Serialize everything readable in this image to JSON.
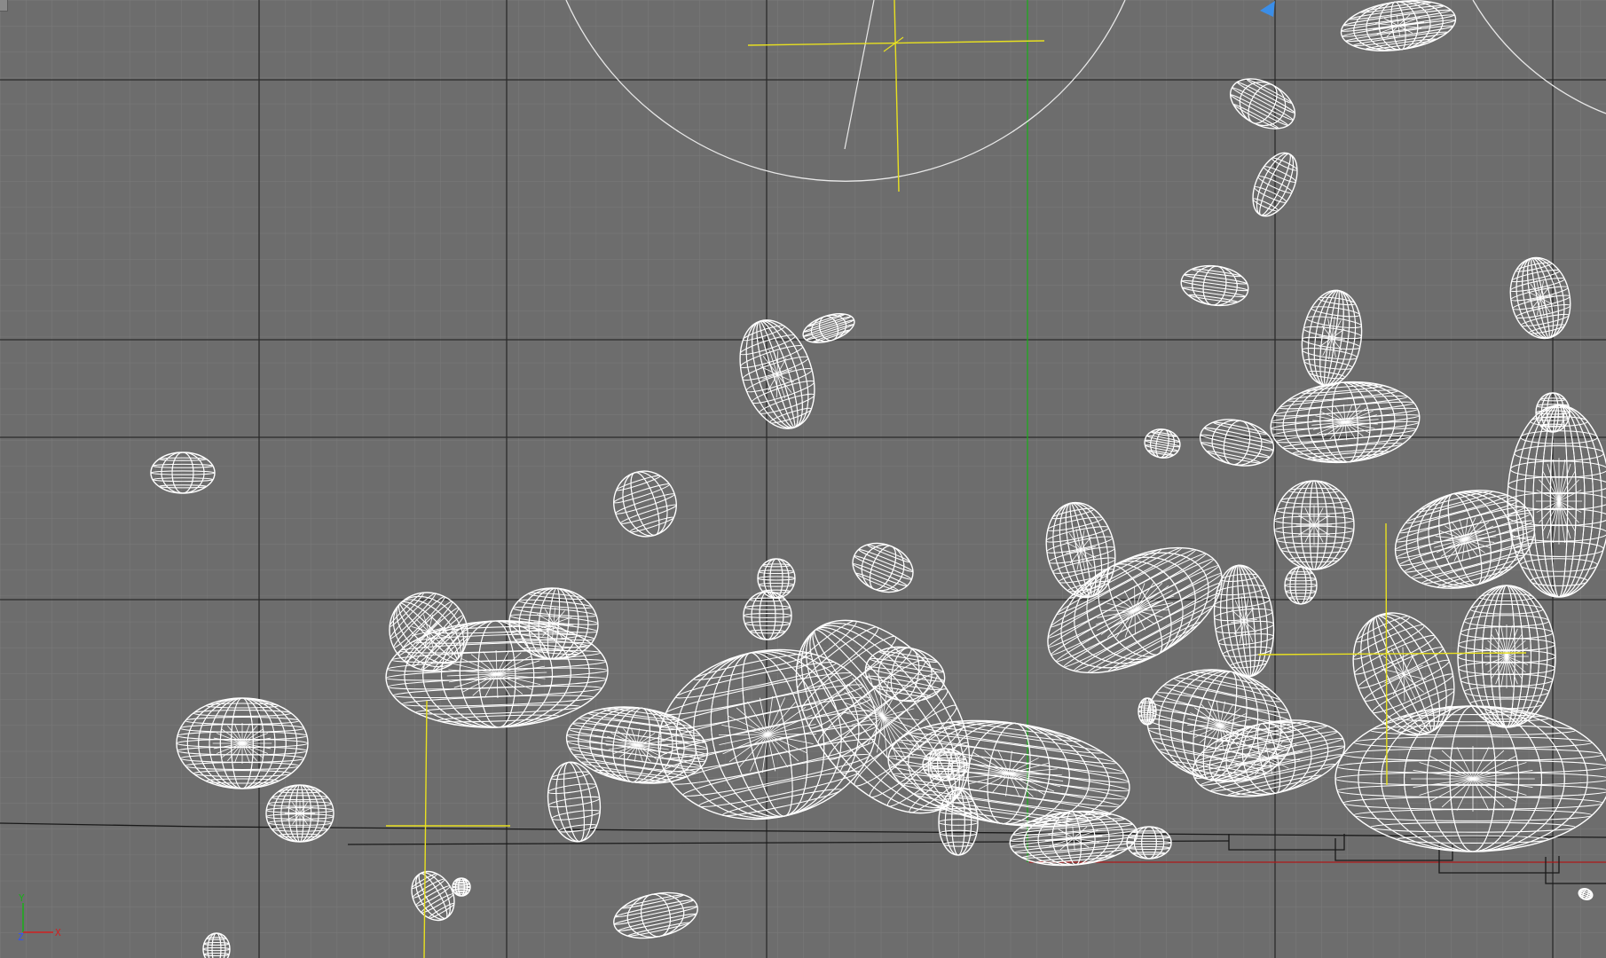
{
  "viewport": {
    "label": "",
    "view": "Front",
    "render_mode": "Wireframe",
    "colors": {
      "background": "#6d6d6d",
      "grid_minor": "#7a7a7a",
      "grid_major": "#2b2b2b",
      "wire": "#ffffff",
      "gizmo": "#e8e020",
      "axis_x": "#d02020",
      "axis_y": "#18b018",
      "axis_z": "#3050ff",
      "light_marker": "#3b8ee8"
    }
  },
  "axis_tripod": {
    "x_label": "X",
    "y_label": "Y",
    "z_label": "Z"
  },
  "objects": {
    "count_visible": 50,
    "type": "ellipsoid-wireframe"
  }
}
